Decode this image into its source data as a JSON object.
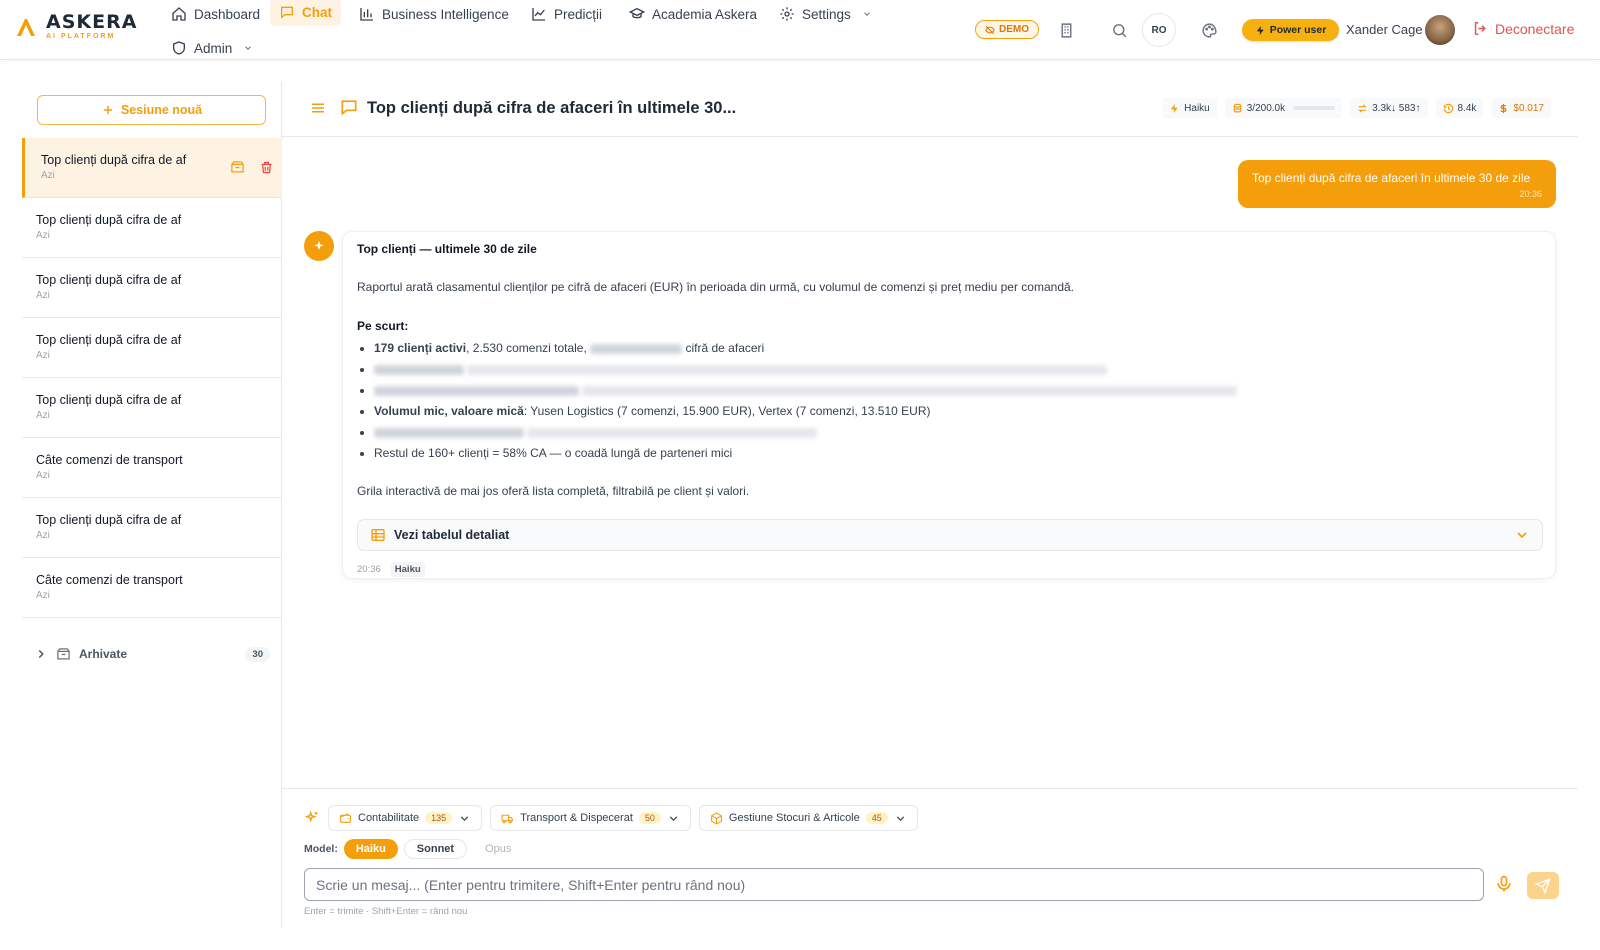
{
  "brand": {
    "name": "ASKERA",
    "sub": "AI PLATFORM",
    "accent": "#f59e0b"
  },
  "nav": {
    "dashboard": "Dashboard",
    "chat": "Chat",
    "bi": "Business Intelligence",
    "predictions": "Predicții",
    "academy": "Academia Askera",
    "settings": "Settings",
    "admin": "Admin"
  },
  "header": {
    "demo": "DEMO",
    "lang": "RO",
    "power": "Power user",
    "user": "Xander Cage",
    "logout": "Deconectare"
  },
  "sidebar": {
    "new_session": "Sesiune nouă",
    "sessions": [
      {
        "title": "Top clienți după cifra de af",
        "date": "Azi",
        "active": true
      },
      {
        "title": "Top clienți după cifra de af",
        "date": "Azi"
      },
      {
        "title": "Top clienți după cifra de af",
        "date": "Azi"
      },
      {
        "title": "Top clienți după cifra de af",
        "date": "Azi"
      },
      {
        "title": "Top clienți după cifra de af",
        "date": "Azi"
      },
      {
        "title": "Câte comenzi de transport",
        "date": "Azi"
      },
      {
        "title": "Top clienți după cifra de af",
        "date": "Azi"
      },
      {
        "title": "Câte comenzi de transport",
        "date": "Azi"
      }
    ],
    "archive_label": "Arhivate",
    "archive_count": "30"
  },
  "chat": {
    "title": "Top clienți după cifra de afaceri în ultimele 30...",
    "stats": {
      "model": "Haiku",
      "tokens": "3/200.0k",
      "tokens_fraction": 2e-05,
      "io": "3.3k↓ 583↑",
      "history": "8.4k",
      "cost": "$0.017"
    },
    "user_message": {
      "text": "Top clienți după cifra de afaceri în ultimele 30 de zile",
      "time": "20:36"
    },
    "bot": {
      "title": "Top clienți — ultimele 30 de zile",
      "intro": "Raportul arată clasamentul clienților pe cifră de afaceri (EUR) în perioada din urmă, cu volumul de comenzi și preț mediu per comandă.",
      "summary_heading": "Pe scurt:",
      "b1_bold": "179 clienți activi",
      "b1_rest": ", 2.530 comenzi totale,",
      "b1_tail": "cifră de afaceri",
      "b4_bold": "Volumul mic, valoare mică",
      "b4_rest": ": Yusen Logistics (7 comenzi, 15.900 EUR), Vertex (7 comenzi, 13.510 EUR)",
      "b6": "Restul de 160+ clienți = 58% CA — o coadă lungă de parteneri mici",
      "footer": "Grila interactivă de mai jos oferă lista completă, filtrabilă pe client și valori.",
      "table_toggle": "Vezi tabelul detaliat",
      "time": "20:36",
      "model": "Haiku"
    }
  },
  "composer": {
    "contexts": [
      {
        "label": "Contabilitate",
        "count": "135"
      },
      {
        "label": "Transport & Dispecerat",
        "count": "50"
      },
      {
        "label": "Gestiune Stocuri & Articole",
        "count": "45"
      }
    ],
    "model_label": "Model:",
    "models": [
      "Haiku",
      "Sonnet",
      "Opus"
    ],
    "placeholder": "Scrie un mesaj... (Enter pentru trimitere, Shift+Enter pentru rând nou)",
    "hint": "Enter = trimite · Shift+Enter = rând nou"
  }
}
